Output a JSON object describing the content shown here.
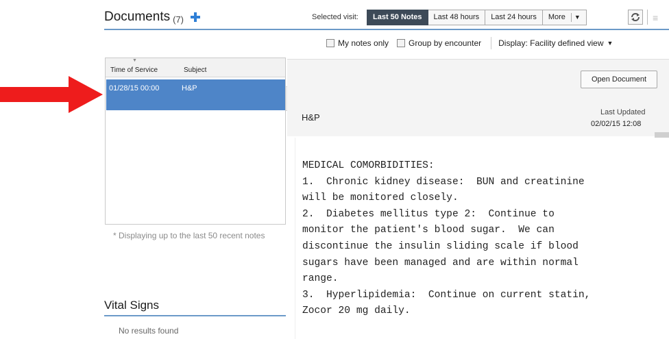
{
  "header": {
    "title": "Documents",
    "count": "(7)",
    "selected_visit_label": "Selected visit:",
    "visit_buttons": [
      "Last 50 Notes",
      "Last 48 hours",
      "Last 24 hours",
      "More"
    ],
    "active_visit_button": "Last 50 Notes"
  },
  "filters": {
    "my_notes_only": "My notes only",
    "group_by_encounter": "Group by encounter",
    "display": "Display: Facility defined view"
  },
  "doc_list": {
    "columns": [
      "Time of Service",
      "Subject"
    ],
    "rows": [
      {
        "time": "01/28/15 00:00",
        "subject": "H&P"
      }
    ],
    "note": "* Displaying up to the last 50 recent notes"
  },
  "vitals": {
    "title": "Vital Signs",
    "empty": "No results found"
  },
  "viewer": {
    "open_button": "Open Document",
    "doc_title": "H&P",
    "last_updated_label": "Last Updated",
    "last_updated_value": "02/02/15 12:08",
    "body_lines": [
      "MEDICAL COMORBIDITIES:",
      "1.  Chronic kidney disease:  BUN and creatinine",
      "will be monitored closely.",
      "2.  Diabetes mellitus type 2:  Continue to",
      "monitor the patient's blood sugar.  We can",
      "discontinue the insulin sliding scale if blood",
      "sugars have been managed and are within normal",
      "range.",
      "3.  Hyperlipidemia:  Continue on current statin,",
      "Zocor 20 mg daily."
    ]
  },
  "colors": {
    "accent_rule": "#6b9ac8",
    "selected_row": "#4e85c8",
    "active_button": "#3d4a58",
    "annotation_arrow": "#ee1c1c",
    "plus_icon": "#2f7fd6"
  },
  "icons": [
    "plus-icon",
    "refresh-icon",
    "menu-icon",
    "annotation-arrow-icon",
    "caret-down-icon",
    "sort-caret-icon"
  ]
}
